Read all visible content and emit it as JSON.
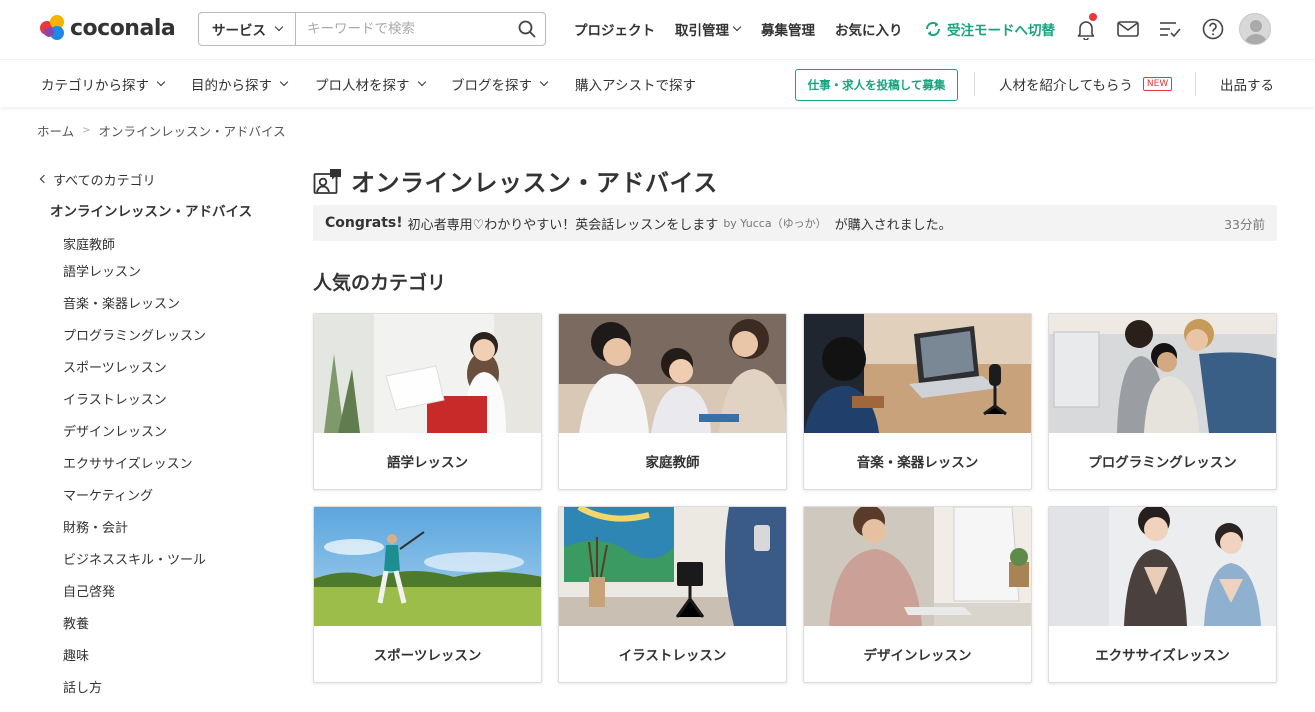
{
  "header": {
    "logo_text": "coconala",
    "search": {
      "category": "サービス",
      "placeholder": "キーワードで検索"
    },
    "nav": [
      "プロジェクト",
      "取引管理",
      "募集管理",
      "お気に入り"
    ],
    "switch_mode": "受注モードへ切替",
    "icons": [
      "bell-icon",
      "mail-icon",
      "checklist-icon",
      "help-icon"
    ],
    "colors": {
      "accent": "#18a37f",
      "badge": "#e8383d"
    }
  },
  "subnav": {
    "items": [
      "カテゴリから探す",
      "目的から探す",
      "プロ人材を探す",
      "ブログを探す",
      "購入アシストで探す"
    ],
    "post_job": "仕事・求人を投稿して募集",
    "introduce": "人材を紹介してもらう",
    "new_badge": "NEW",
    "sell": "出品する"
  },
  "breadcrumb": [
    "ホーム",
    "オンラインレッスン・アドバイス"
  ],
  "sidebar": {
    "back": "すべてのカテゴリ",
    "current": "オンラインレッスン・アドバイス",
    "items": [
      "家庭教師",
      "語学レッスン",
      "音楽・楽器レッスン",
      "プログラミングレッスン",
      "スポーツレッスン",
      "イラストレッスン",
      "デザインレッスン",
      "エクササイズレッスン",
      "マーケティング",
      "財務・会計",
      "ビジネススキル・ツール",
      "自己啓発",
      "教養",
      "趣味",
      "話し方"
    ]
  },
  "main": {
    "title": "オンラインレッスン・アドバイス",
    "congrats": {
      "label": "Congrats!",
      "service": "初心者専用♡わかりやすい！英会話レッスンをします",
      "by": "by Yucca（ゆっか）",
      "suffix": "が購入されました。",
      "time": "33分前"
    },
    "popular_title": "人気のカテゴリ",
    "categories": [
      "語学レッスン",
      "家庭教師",
      "音楽・楽器レッスン",
      "プログラミングレッスン",
      "スポーツレッスン",
      "イラストレッスン",
      "デザインレッスン",
      "エクササイズレッスン"
    ]
  }
}
